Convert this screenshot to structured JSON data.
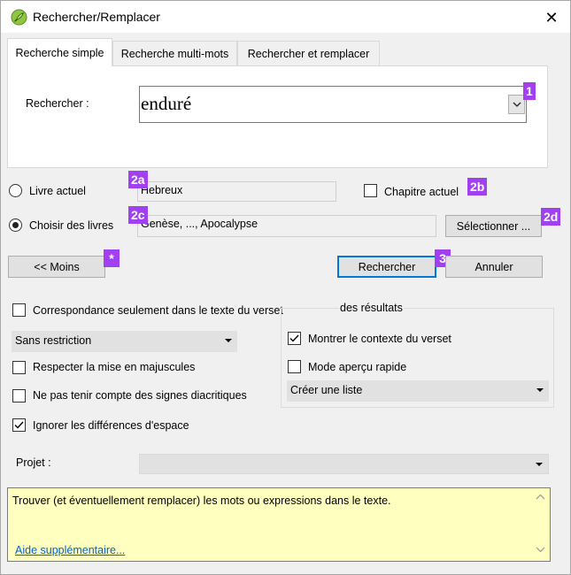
{
  "window": {
    "title": "Rechercher/Remplacer",
    "close_glyph": "✕",
    "app_icon": "leaf-icon"
  },
  "tabs": [
    {
      "label": "Recherche simple",
      "active": true
    },
    {
      "label": "Recherche multi-mots",
      "active": false
    },
    {
      "label": "Rechercher et remplacer",
      "active": false
    }
  ],
  "search": {
    "label": "Rechercher :",
    "value": "enduré"
  },
  "badges": {
    "b1": "1",
    "b2a": "2a",
    "b2b": "2b",
    "b2c": "2c",
    "b2d": "2d",
    "b3": "3",
    "star": "*"
  },
  "scope": {
    "current_book_label": "Livre actuel",
    "current_book_value": "Hebreux",
    "current_chapter_label": "Chapitre actuel",
    "current_chapter_checked": false,
    "choose_books_label": "Choisir des livres",
    "choose_books_value": "Genèse, ..., Apocalypse",
    "choose_books_selected": true,
    "select_button": "Sélectionner ..."
  },
  "actions": {
    "less_button": "<< Moins",
    "search_button": "Rechercher",
    "cancel_button": "Annuler"
  },
  "options": {
    "verse_text_only_label": "Correspondance seulement dans le texte du verset",
    "verse_text_only_checked": false,
    "restriction_value": "Sans restriction",
    "match_case_label": "Respecter la mise en majuscules",
    "match_case_checked": false,
    "ignore_diacritics_label": "Ne pas tenir compte des signes diacritiques",
    "ignore_diacritics_checked": false,
    "ignore_whitespace_label": "Ignorer les différences d'espace",
    "ignore_whitespace_checked": true
  },
  "results": {
    "group_title": "des résultats",
    "show_context_label": "Montrer le contexte du verset",
    "show_context_checked": true,
    "quick_preview_label": "Mode aperçu rapide",
    "quick_preview_checked": false,
    "output_value": "Créer une liste"
  },
  "project": {
    "label": "Projet :",
    "value": ""
  },
  "help": {
    "text": "Trouver (et éventuellement remplacer) les mots ou expressions dans le texte.",
    "link": "Aide supplémentaire..."
  },
  "colors": {
    "badge": "#a040f0",
    "help_bg": "#ffffc0",
    "link": "#0066cc",
    "default_button_border": "#0078d7"
  }
}
